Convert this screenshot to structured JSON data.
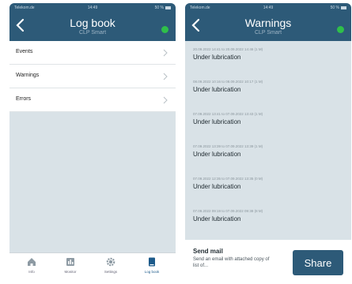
{
  "status_bar": {
    "carrier": "Telekom.de",
    "time": "14:49",
    "battery": "50 %"
  },
  "logbook_screen": {
    "title": "Log book",
    "subtitle": "CLP Smart",
    "menu": [
      {
        "label": "Events"
      },
      {
        "label": "Warnings"
      },
      {
        "label": "Errors"
      }
    ],
    "tabs": [
      {
        "label": "Info"
      },
      {
        "label": "Monitor"
      },
      {
        "label": "Settings"
      },
      {
        "label": "Log book"
      }
    ],
    "active_tab": "Log book",
    "status_dot_color": "#2fbf4a"
  },
  "warnings_screen": {
    "title": "Warnings",
    "subtitle": "CLP Smart",
    "entries": [
      {
        "time": "20.09.2022 14:41 to 20.09.2022 14:46 (1 M)",
        "title": "Under lubrication"
      },
      {
        "time": "08.09.2022 10:16 to 08.09.2022 10:17 (1 M)",
        "title": "Under lubrication"
      },
      {
        "time": "07.09.2022 13:41 to 07.09.2022 13:43 (1 M)",
        "title": "Under lubrication"
      },
      {
        "time": "07.09.2022 13:39 to 07.09.2022 13:39 (1 M)",
        "title": "Under lubrication"
      },
      {
        "time": "07.09.2022 12:35 to 07.09.2022 13:35 (0 M)",
        "title": "Under lubrication"
      },
      {
        "time": "07.09.2022 09:19 to 07.09.2022 09:38 (8 M)",
        "title": "Under lubrication"
      }
    ],
    "send_mail": {
      "title": "Send mail",
      "description": "Send an email with attached copy of list of...",
      "button": "Share"
    }
  },
  "colors": {
    "nav": "#2d5a78",
    "background": "#d9e2e7",
    "accent_green": "#2fbf4a"
  }
}
